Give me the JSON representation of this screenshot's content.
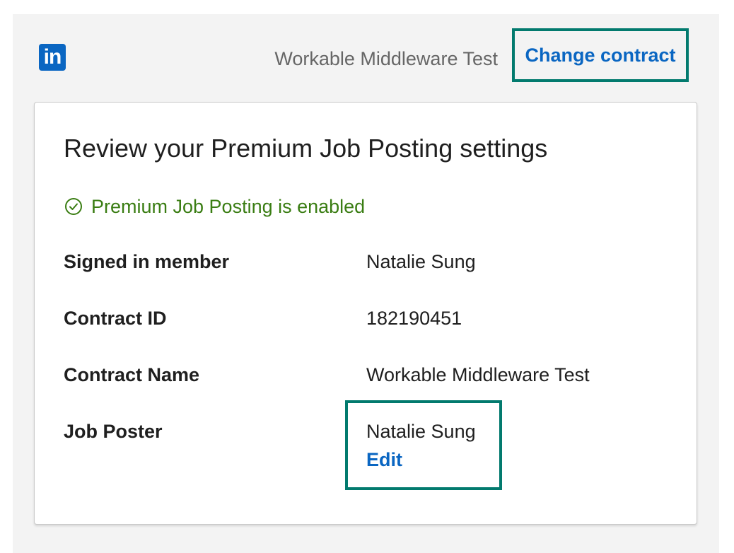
{
  "header": {
    "logo_text": "in",
    "contract_title": "Workable Middleware Test",
    "change_contract_label": "Change contract"
  },
  "card": {
    "title": "Review your Premium Job Posting settings",
    "status_text": "Premium Job Posting is enabled",
    "rows": [
      {
        "label": "Signed in member",
        "value": "Natalie Sung"
      },
      {
        "label": "Contract ID",
        "value": "182190451"
      },
      {
        "label": "Contract Name",
        "value": "Workable Middleware Test"
      },
      {
        "label": "Job Poster",
        "value": "Natalie Sung"
      }
    ],
    "edit_label": "Edit"
  },
  "colors": {
    "brand": "#0a66c2",
    "highlight_border": "#027a6e",
    "success": "#3a7d13"
  },
  "icons": {
    "logo": "linkedin-logo",
    "status": "check-circle-icon"
  }
}
